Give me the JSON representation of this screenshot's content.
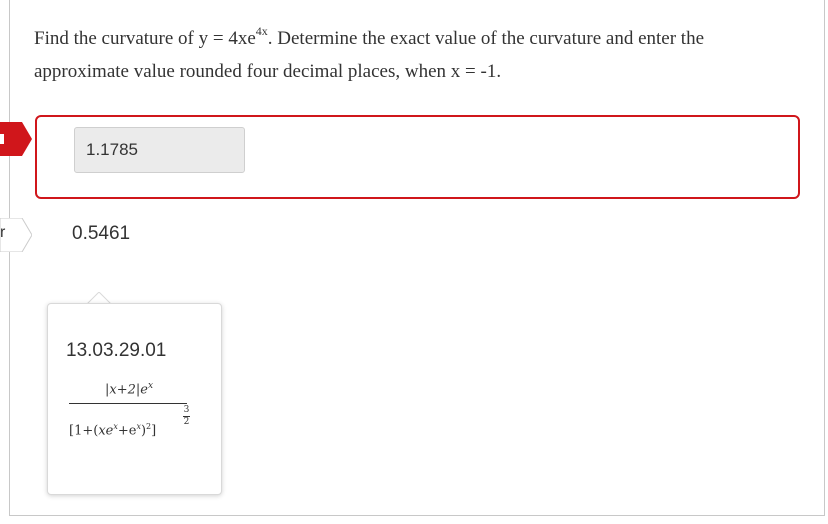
{
  "question": {
    "text_before": "Find the curvature of y = 4xe",
    "exponent": "4x",
    "text_after": ". Determine the exact value of the curvature and enter the approximate value rounded four decimal places, when x = -1."
  },
  "answer": {
    "value": "1.1785"
  },
  "correct": {
    "value": "0.5461"
  },
  "flags": {
    "second_letter": "r"
  },
  "tooltip": {
    "code": "13.03.29.01",
    "numerator": "|x+2|e",
    "numerator_exp": "x",
    "den_open": "[1+(",
    "den_x": "xe",
    "den_x_exp": "x",
    "den_plus": "+e",
    "den_e_exp": "x",
    "den_close": ")",
    "den_sq": "2",
    "den_end": "]",
    "power_num": "3",
    "power_den": "2"
  },
  "colors": {
    "error": "#d0161b",
    "field_bg": "#ebebeb"
  }
}
